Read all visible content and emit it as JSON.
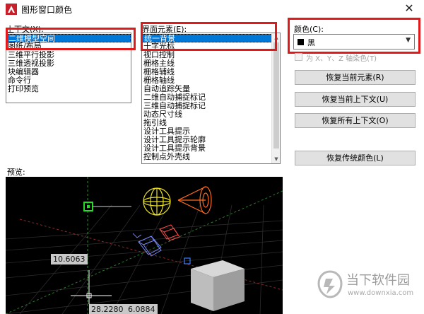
{
  "window": {
    "title": "图形窗口颜色",
    "close_symbol": "✕"
  },
  "context": {
    "label": "上下文(X):",
    "items": [
      "二维模型空间",
      "图纸/布局",
      "三维平行投影",
      "三维透视投影",
      "块编辑器",
      "命令行",
      "打印预览"
    ],
    "selected_index": 0
  },
  "interface": {
    "label": "界面元素(E):",
    "items": [
      "统一背景",
      "十字光标",
      "视口控制",
      "栅格主线",
      "栅格辅线",
      "栅格轴线",
      "自动追踪矢量",
      "二维自动捕捉标记",
      "三维自动捕捉标记",
      "动态尺寸线",
      "拖引线",
      "设计工具提示",
      "设计工具提示轮廓",
      "设计工具提示背景",
      "控制点外壳线"
    ],
    "selected_index": 0
  },
  "color": {
    "label": "颜色(C):",
    "value": "黑",
    "swatch_color": "#000000",
    "tint_label": "为 X、Y、Z 轴染色(T)"
  },
  "buttons": {
    "restore_element": "恢复当前元素(R)",
    "restore_context": "恢复当前上下文(U)",
    "restore_all": "恢复所有上下文(O)",
    "restore_classic": "恢复传统颜色(L)"
  },
  "preview": {
    "label": "预览:",
    "dim_value": "10.6063",
    "coord_x": "28.2280",
    "coord_y": "6.0884"
  },
  "watermark": {
    "title": "当下软件园",
    "url": "www.downxia.com"
  },
  "colors": {
    "selection": "#0078d7",
    "highlight_box": "#e0191b",
    "preview_bg": "#000000"
  }
}
